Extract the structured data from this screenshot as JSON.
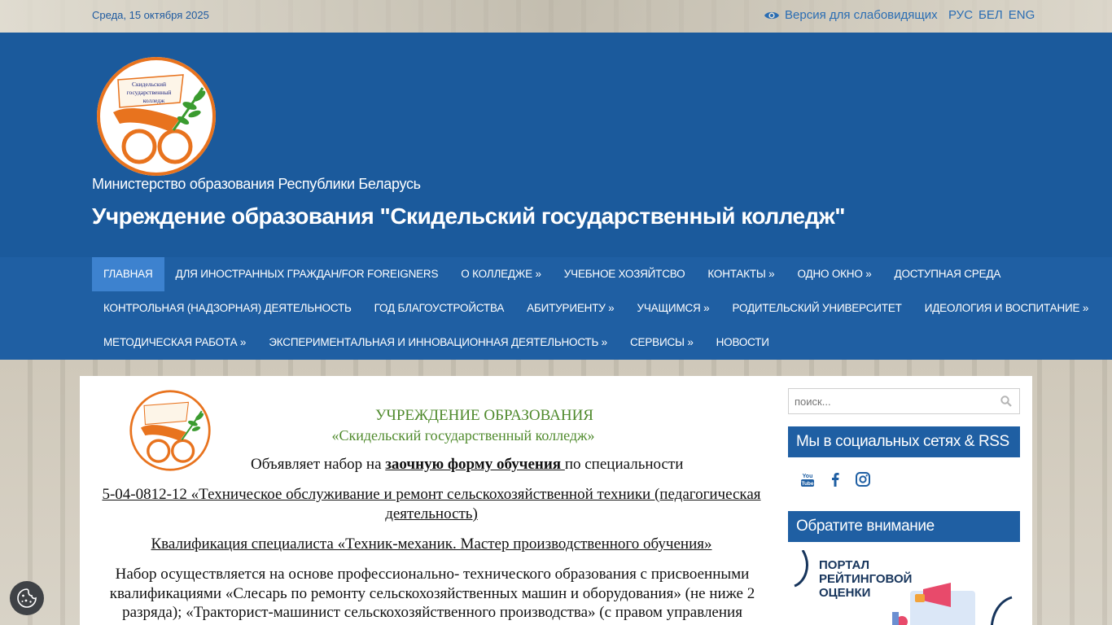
{
  "topbar": {
    "date": "Среда, 15 октября 2025",
    "vision_label": "Версия для слабовидящих",
    "languages": [
      "РУС",
      "БЕЛ",
      "ENG"
    ]
  },
  "header": {
    "ministry": "Министерство образования Республики Беларусь",
    "title": "Учреждение образования \"Скидельский государственный колледж\"",
    "logo_text": [
      "Скидельский",
      "государственный",
      "колледж"
    ]
  },
  "nav": {
    "rows": [
      [
        "Главная",
        "Для иностранных граждан/For foreigners",
        "О колледже »",
        "Учебное хозяйтсво",
        "Контакты »",
        "Одно окно »",
        "Доступная среда"
      ],
      [
        "Контрольная (надзорная) деятельность",
        "Год благоустройства",
        "Абитуриенту »",
        "Учащимся »",
        "Родительский университет",
        "Идеология и воспитание »"
      ],
      [
        "Методическая работа »",
        "Экспериментальная и инновационная деятельность »",
        "Сервисы »",
        "Новости"
      ]
    ],
    "active": "Главная"
  },
  "poster": {
    "title1": "УЧРЕЖДЕНИЕ ОБРАЗОВАНИЯ",
    "title2": "«Скидельский государственный колледж»",
    "announce_pre": "Объявляет набор на ",
    "announce_bold": "заочную форму обучения ",
    "announce_post": "по специальности",
    "specialty": "5-04-0812-12 «Техническое обслуживание и ремонт сельскохозяйственной техники (педагогическая деятельность)",
    "qualification": "Квалификация специалиста «Техник-механик. Мастер производственного обучения»",
    "body": "Набор осуществляется на основе профессионально- технического образования с присвоенными квалификациями «Слесарь по ремонту сельскохозяйственных машин и оборудования» (не ниже 2 разряда); «Тракторист-машинист сельскохозяйственного производства» (с правом управления колёсными тракторами, самоходными машинами категории «С»."
  },
  "sidebar": {
    "search_placeholder": "поиск...",
    "social_title": "Мы в социальных сетях & RSS",
    "social_icons": [
      "youtube-icon",
      "facebook-icon",
      "instagram-icon"
    ],
    "notice_title": "Обратите внимание",
    "portal_text": [
      "ПОРТАЛ",
      "РЕЙТИНГОВОЙ",
      "ОЦЕНКИ"
    ]
  },
  "colors": {
    "header_blue": "#1b5a9c",
    "nav_blue": "#1f5fa3",
    "active_blue": "#3d82cf",
    "logo_orange": "#e8731e",
    "poster_green": "#4f8a2c"
  }
}
